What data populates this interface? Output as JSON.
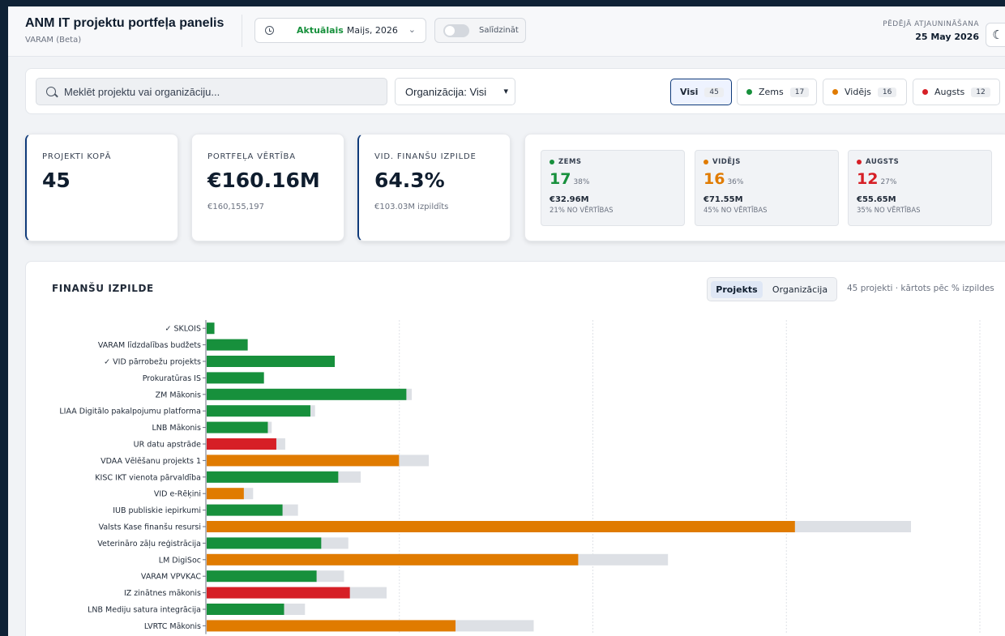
{
  "header": {
    "title": "ANM IT projektu portfeļa panelis",
    "subtitle": "VARAM (Beta)",
    "period_tag": "Aktuālais",
    "period_value": "Maijs, 2026",
    "compare_label": "Salīdzināt",
    "updated_label": "PĒDĒJĀ ATJAUNINĀŠANA",
    "updated_date": "25 May 2026"
  },
  "filters": {
    "search_placeholder": "Meklēt projektu vai organizāciju...",
    "org_select": "Organizācija: Visi",
    "risk": [
      {
        "label": "Visi",
        "count": "45",
        "color": "",
        "active": true
      },
      {
        "label": "Zems",
        "count": "17",
        "color": "#17903c",
        "active": false
      },
      {
        "label": "Vidējs",
        "count": "16",
        "color": "#e07b00",
        "active": false
      },
      {
        "label": "Augsts",
        "count": "12",
        "color": "#d61f26",
        "active": false
      }
    ]
  },
  "kpis": {
    "total": {
      "label": "PROJEKTI KOPĀ",
      "value": "45"
    },
    "portfolio": {
      "label": "PORTFEĻA VĒRTĪBA",
      "value": "€160.16M",
      "sub": "€160,155,197"
    },
    "finance": {
      "label": "VID. FINANŠU IZPILDE",
      "value": "64.3%",
      "sub": "€103.03M izpildīts"
    }
  },
  "risk_cards": [
    {
      "label": "ZEMS",
      "count": "17",
      "pct": "38%",
      "amount": "€32.96M",
      "share": "21% NO VĒRTĪBAS",
      "color": "#17903c"
    },
    {
      "label": "VIDĒJS",
      "count": "16",
      "pct": "36%",
      "amount": "€71.55M",
      "share": "45% NO VĒRTĪBAS",
      "color": "#e07b00"
    },
    {
      "label": "AUGSTS",
      "count": "12",
      "pct": "27%",
      "amount": "€55.65M",
      "share": "35% NO VĒRTĪBAS",
      "color": "#d61f26"
    }
  ],
  "finance_panel": {
    "title": "FINANŠU IZPILDE",
    "toggle": [
      "Projekts",
      "Organizācija"
    ],
    "sort_info": "45 projekti · kārtots pēc % izpildes"
  },
  "chart_data": {
    "type": "bar",
    "orientation": "horizontal",
    "grid": true,
    "xlim": [
      0,
      20
    ],
    "series": [
      {
        "name": "",
        "role": "executed"
      },
      {
        "name": "",
        "role": "budget"
      }
    ],
    "categories": [
      "✓ SKLOIS",
      "VARAM līdzdalības budžets",
      "✓ VID pārrobežu projekts",
      "Prokuratūras IS",
      "ZM Mākonis",
      "LIAA Digitālo pakalpojumu platforma",
      "LNB Mākonis",
      "UR datu apstrāde",
      "VDAA Vēlēšanu projekts 1",
      "KISC IKT vienota pārvaldība",
      "VID e-Rēķini",
      "IUB publiskie iepirkumi",
      "Valsts Kase finanšu resursi",
      "Veterinārо zāļu reģistrācija",
      "LM DigiSoc",
      "VARAM VPVKAC",
      "IZ zinātnes mākonis",
      "LNB Mediju satura integrācija",
      "LVRTC Mākonis"
    ],
    "executed": [
      0.2,
      1.06,
      3.31,
      1.48,
      5.16,
      2.68,
      1.58,
      1.8,
      4.97,
      3.4,
      0.96,
      1.96,
      15.2,
      2.96,
      9.6,
      2.84,
      3.7,
      2.0,
      6.43
    ],
    "budget": [
      0.2,
      1.06,
      3.31,
      1.48,
      5.3,
      2.8,
      1.68,
      2.03,
      5.74,
      3.98,
      1.2,
      2.36,
      18.2,
      3.66,
      11.92,
      3.55,
      4.65,
      2.54,
      8.45
    ],
    "risk": [
      "low",
      "low",
      "low",
      "low",
      "low",
      "low",
      "low",
      "high",
      "medium",
      "low",
      "medium",
      "low",
      "medium",
      "low",
      "medium",
      "low",
      "high",
      "low",
      "medium"
    ],
    "colors": {
      "low": "#17903c",
      "medium": "#e07b00",
      "high": "#d61f26",
      "remaining": "#dde0e5"
    }
  }
}
